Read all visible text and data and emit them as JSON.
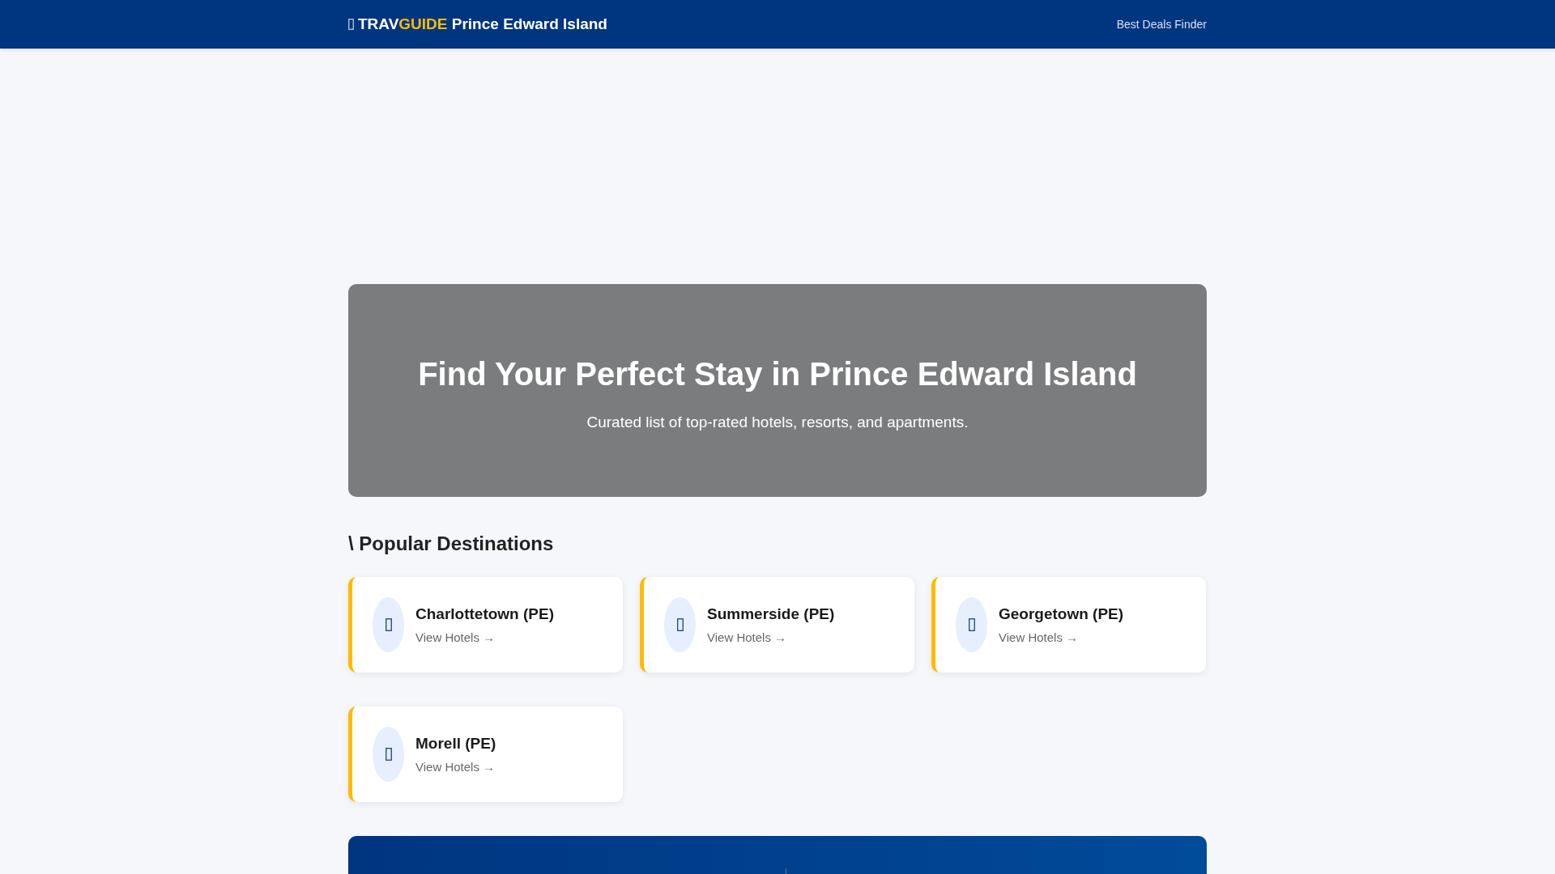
{
  "header": {
    "brand": {
      "part1": "TRAV",
      "part2": "GUIDE",
      "place": "Prince Edward Island"
    },
    "nav_link": "Best Deals Finder"
  },
  "hero": {
    "title": "Find Your Perfect Stay in Prince Edward Island",
    "subtitle": "Curated list of top-rated hotels, resorts, and apartments."
  },
  "destinations": {
    "heading_mark": "\\",
    "heading": "Popular Destinations",
    "items": [
      {
        "name": "Charlottetown (PE)",
        "link": "View Hotels →"
      },
      {
        "name": "Summerside (PE)",
        "link": "View Hotels →"
      },
      {
        "name": "Georgetown (PE)",
        "link": "View Hotels →"
      },
      {
        "name": "Morell (PE)",
        "link": "View Hotels →"
      }
    ]
  }
}
